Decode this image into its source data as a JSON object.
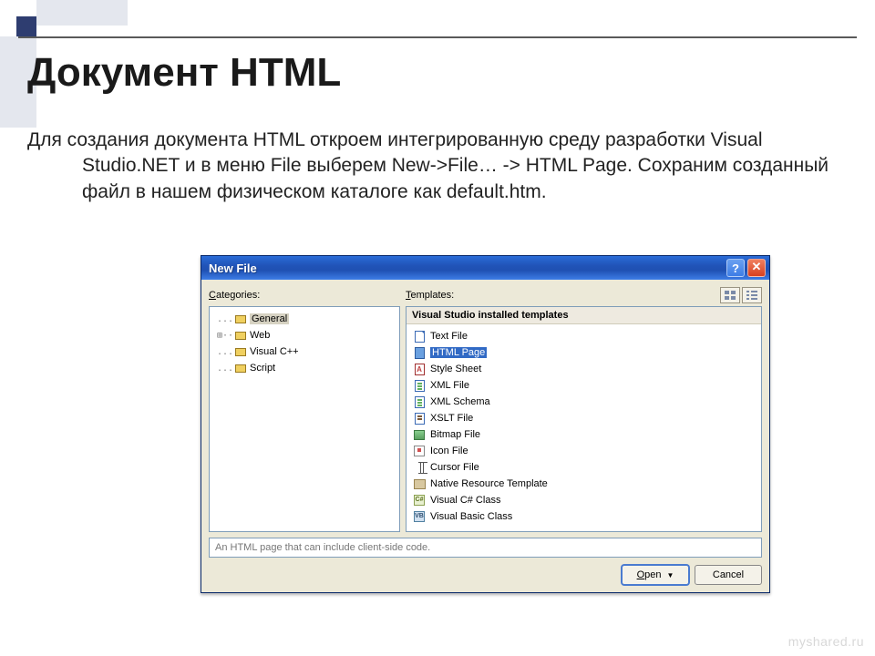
{
  "slide": {
    "title": "Документ HTML",
    "body": "Для создания документа HTML откроем интегрированную среду разработки Visual Studio.NET и в меню File выберем New->File… -> HTML Page. Сохраним созданный файл в нашем физическом каталоге как default.htm."
  },
  "dialog": {
    "title": "New File",
    "labels": {
      "categories": "Categories:",
      "templates": "Templates:"
    },
    "categories": [
      {
        "label": "General",
        "selected": true,
        "twig": "....."
      },
      {
        "label": "Web",
        "selected": false,
        "twig": "⊞··"
      },
      {
        "label": "Visual C++",
        "selected": false,
        "twig": "....."
      },
      {
        "label": "Script",
        "selected": false,
        "twig": "....."
      }
    ],
    "templates_header": "Visual Studio installed templates",
    "templates": [
      {
        "label": "Text File",
        "icon": "doc",
        "selected": false
      },
      {
        "label": "HTML Page",
        "icon": "html",
        "selected": true
      },
      {
        "label": "Style Sheet",
        "icon": "style",
        "selected": false
      },
      {
        "label": "XML File",
        "icon": "xml",
        "selected": false
      },
      {
        "label": "XML Schema",
        "icon": "xml",
        "selected": false
      },
      {
        "label": "XSLT File",
        "icon": "xslt",
        "selected": false
      },
      {
        "label": "Bitmap File",
        "icon": "bitmap",
        "selected": false
      },
      {
        "label": "Icon File",
        "icon": "icon",
        "selected": false
      },
      {
        "label": "Cursor File",
        "icon": "cursor",
        "selected": false
      },
      {
        "label": "Native Resource Template",
        "icon": "native",
        "selected": false
      },
      {
        "label": "Visual C# Class",
        "icon": "cs",
        "selected": false
      },
      {
        "label": "Visual Basic Class",
        "icon": "vb",
        "selected": false
      }
    ],
    "description": "An HTML page that can include client-side code.",
    "buttons": {
      "open": "Open",
      "cancel": "Cancel"
    }
  },
  "watermark": "myshared.ru"
}
